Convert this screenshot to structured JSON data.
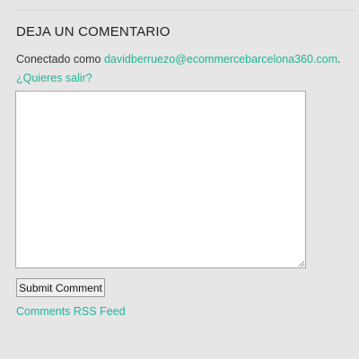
{
  "comment_section": {
    "heading": "DEJA UN COMENTARIO",
    "logged_in_prefix": "Conectado como ",
    "user_email": "davidberruezo@ecommercebarcelona360.com",
    "separator": ". ",
    "logout_label": "¿Quieres salir?",
    "comment_value": "",
    "submit_label": "Submit Comment",
    "rss_label": "Comments RSS Feed"
  },
  "colors": {
    "background": "#e6e6e6",
    "link_accent": "#1fb594",
    "heading_text": "#222222",
    "body_text": "#333333"
  }
}
